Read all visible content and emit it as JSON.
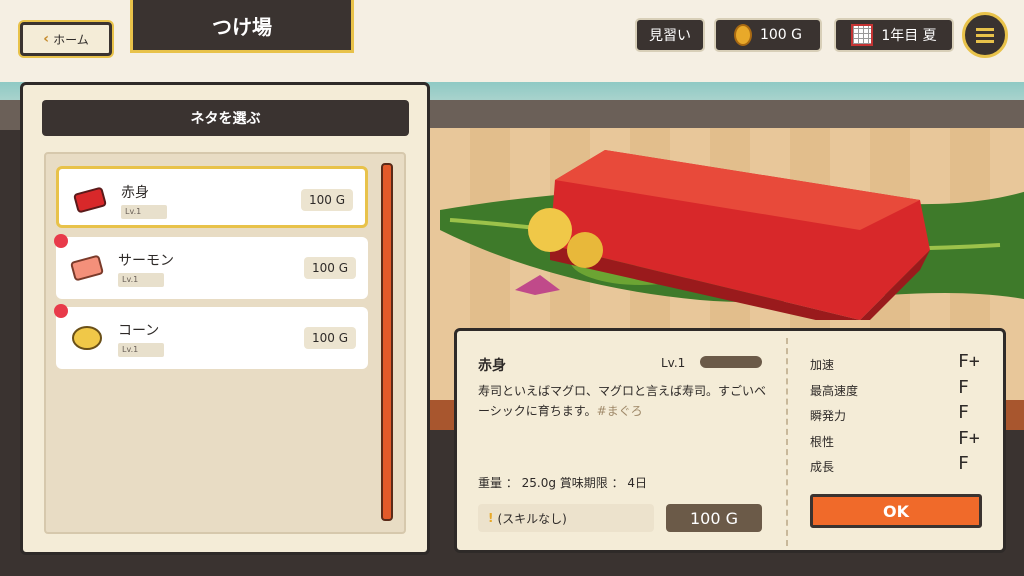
{
  "topbar": {
    "home_label": "ホーム",
    "screen_title": "つけ場",
    "rank": "見習い",
    "gold": "100 G",
    "date": "1年目 夏"
  },
  "panel": {
    "header": "ネタを選ぶ",
    "items": [
      {
        "name": "赤身",
        "level": "Lv.1",
        "price": "100 G",
        "selected": true,
        "new": false
      },
      {
        "name": "サーモン",
        "level": "Lv.1",
        "price": "100 G",
        "selected": false,
        "new": true
      },
      {
        "name": "コーン",
        "level": "Lv.1",
        "price": "100 G",
        "selected": false,
        "new": true
      }
    ]
  },
  "detail": {
    "name": "赤身",
    "level": "Lv.1",
    "description": "寿司といえばマグロ、マグロと言えば寿司。すごいベーシックに育ちます。",
    "tag": "#まぐろ",
    "weight": "重量 ： 25.0g 賞味期限 ： 4日",
    "skill": "(スキルなし)",
    "price": "100 G",
    "stats": [
      {
        "name": "加速",
        "grade": "F+"
      },
      {
        "name": "最高速度",
        "grade": "F"
      },
      {
        "name": "瞬発力",
        "grade": "F"
      },
      {
        "name": "根性",
        "grade": "F+"
      },
      {
        "name": "成長",
        "grade": "F"
      }
    ],
    "ok_label": "OK"
  },
  "colors": {
    "accent": "#e8c24a",
    "dark": "#3a3330",
    "ok": "#f06a2a",
    "tuna": "#d8282a"
  }
}
